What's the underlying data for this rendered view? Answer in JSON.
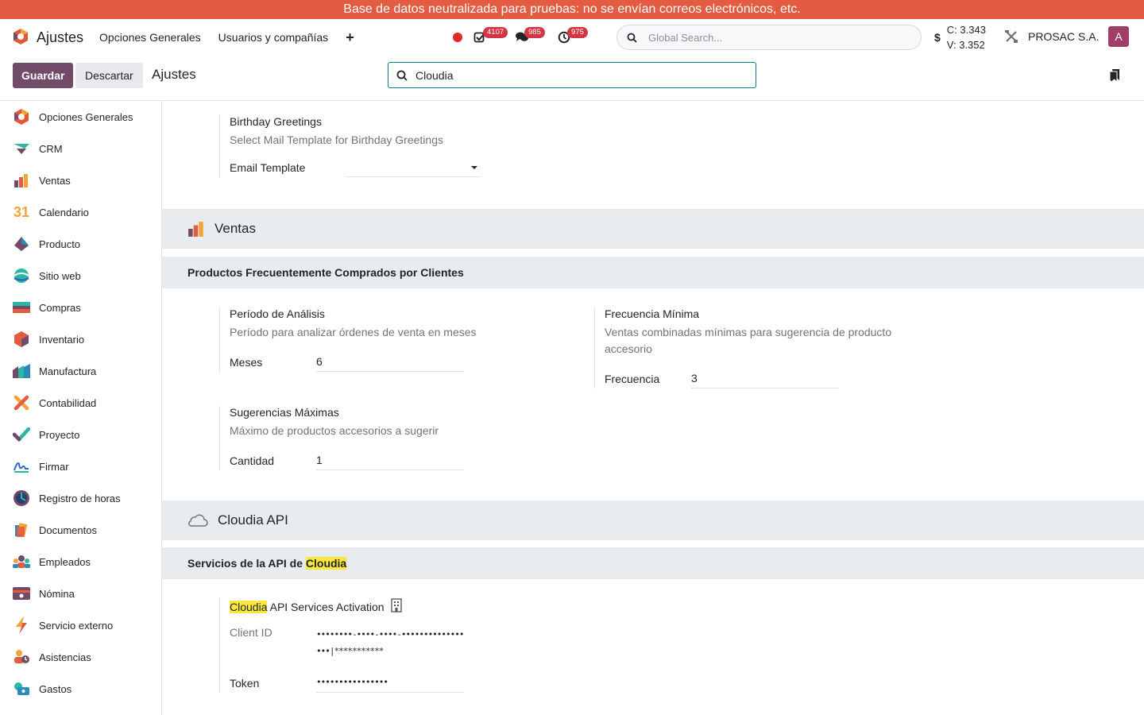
{
  "banner": "Base de datos neutralizada para pruebas: no se envían correos electrónicos, etc.",
  "navbar": {
    "app_title": "Ajustes",
    "menus": [
      "Opciones Generales",
      "Usuarios y compañías"
    ],
    "activity_count": "4107",
    "messages_count": "985",
    "timer_count": "975",
    "global_search_placeholder": "Global Search...",
    "currency_symbol": "$",
    "rate_c": "C: 3.343",
    "rate_v": "V: 3.352",
    "company": "PROSAC S.A.",
    "avatar_letter": "A"
  },
  "controlbar": {
    "save_label": "Guardar",
    "discard_label": "Descartar",
    "breadcrumb": "Ajustes",
    "search_value": "Cloudia"
  },
  "sidebar": {
    "items": [
      {
        "label": "Opciones Generales",
        "icon": "settings-app-icon"
      },
      {
        "label": "CRM",
        "icon": "crm-app-icon"
      },
      {
        "label": "Ventas",
        "icon": "sales-app-icon"
      },
      {
        "label": "Calendario",
        "icon": "calendar-app-icon"
      },
      {
        "label": "Producto",
        "icon": "product-app-icon"
      },
      {
        "label": "Sitio web",
        "icon": "website-app-icon"
      },
      {
        "label": "Compras",
        "icon": "purchase-app-icon"
      },
      {
        "label": "Inventario",
        "icon": "inventory-app-icon"
      },
      {
        "label": "Manufactura",
        "icon": "manufacturing-app-icon"
      },
      {
        "label": "Contabilidad",
        "icon": "accounting-app-icon"
      },
      {
        "label": "Proyecto",
        "icon": "project-app-icon"
      },
      {
        "label": "Firmar",
        "icon": "sign-app-icon"
      },
      {
        "label": "Registro de horas",
        "icon": "timesheet-app-icon"
      },
      {
        "label": "Documentos",
        "icon": "documents-app-icon"
      },
      {
        "label": "Empleados",
        "icon": "employees-app-icon"
      },
      {
        "label": "Nómina",
        "icon": "payroll-app-icon"
      },
      {
        "label": "Servicio externo",
        "icon": "field-service-app-icon"
      },
      {
        "label": "Asistencias",
        "icon": "attendances-app-icon"
      },
      {
        "label": "Gastos",
        "icon": "expenses-app-icon"
      }
    ]
  },
  "content": {
    "birthday": {
      "title": "Birthday Greetings",
      "desc": "Select Mail Template for Birthday Greetings",
      "field_label": "Email Template",
      "field_value": ""
    },
    "ventas_band": "Ventas",
    "frequent_band": "Productos Frecuentemente Comprados por Clientes",
    "periodo": {
      "title": "Período de Análisis",
      "desc": "Período para analizar órdenes de venta en meses",
      "field_label": "Meses",
      "field_value": "6"
    },
    "frecuencia": {
      "title": "Frecuencia Mínima",
      "desc": "Ventas combinadas mínimas para sugerencia de producto accesorio",
      "field_label": "Frecuencia",
      "field_value": "3"
    },
    "sugerencias": {
      "title": "Sugerencias Máximas",
      "desc": "Máximo de productos accesorios a sugerir",
      "field_label": "Cantidad",
      "field_value": "1"
    },
    "cloudia_band": "Cloudia API",
    "services_band_prefix": "Servicios de la API de ",
    "services_band_highlight": "Cloudia",
    "activation": {
      "title_highlight": "Cloudia",
      "title_rest": " API Services Activation",
      "client_id_label": "Client ID",
      "client_id_value": "••••••••-••••-••••-•••••••••••••••••|***********",
      "token_label": "Token",
      "token_value": "••••••••••••••••"
    }
  },
  "colors": {
    "banner": "#e35b40",
    "primary": "#714b67",
    "badge": "#d33545",
    "highlight": "#fde73b",
    "band": "#e9ecef"
  }
}
